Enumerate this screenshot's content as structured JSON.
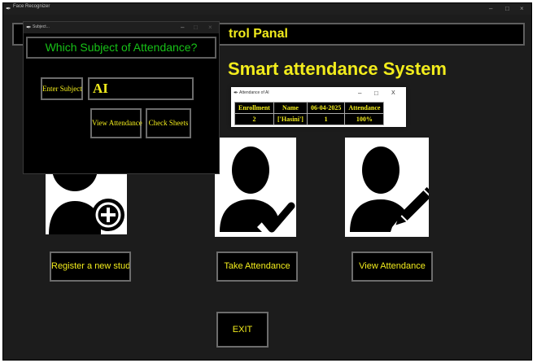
{
  "main_window": {
    "title": "Face Recognizer",
    "minimize": "–",
    "maximize": "□",
    "close": "×"
  },
  "control_bar": {
    "text": "trol Panal"
  },
  "system_title": "Smart attendance System",
  "actions": {
    "register": "Register a new student",
    "take_attendance": "Take Attendance",
    "view_attendance": "View Attendance",
    "exit": "EXIT"
  },
  "subject_window": {
    "title": "Subject...",
    "heading": "Which Subject of Attendance?",
    "enter_subject_label": "Enter Subject",
    "subject_value": "AI",
    "view_attendance_button": "View Attendance",
    "check_sheets_button": "Check Sheets",
    "minimize": "–",
    "maximize": "□",
    "close": "×"
  },
  "attendance_window": {
    "title": "Attendance of AI",
    "minimize": "–",
    "maximize": "□",
    "close": "X",
    "headers": [
      "Enrollment",
      "Name",
      "06-04-2025",
      "Attendance"
    ],
    "rows": [
      [
        "2",
        "['Hasini']",
        "1",
        "100%"
      ]
    ]
  },
  "icons": [
    "feather-icon",
    "add-user-icon",
    "check-user-icon",
    "edit-user-icon"
  ],
  "colors": {
    "accent_yellow": "#f2ec1c",
    "heading_green": "#17c217",
    "window_bg": "#1c1c1c"
  }
}
